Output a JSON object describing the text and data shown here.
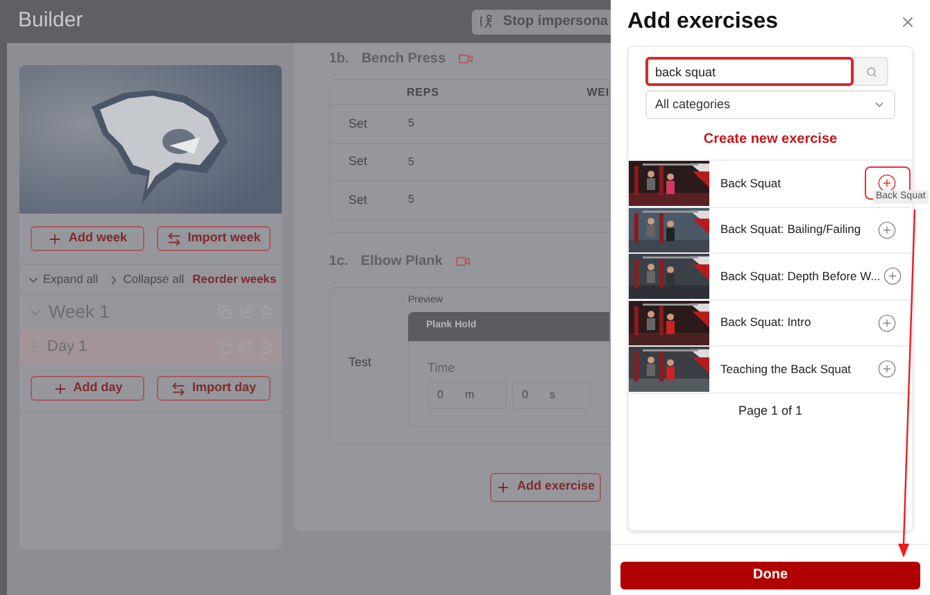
{
  "header": {
    "title": "Builder",
    "stop_button": "Stop impersona"
  },
  "program": {
    "week_buttons": [
      "Add week",
      "Import week"
    ],
    "expand": "Expand all",
    "collapse": "Collapse all",
    "reorder": "Reorder weeks",
    "weeks": [
      {
        "label": "Week 1",
        "expanded": true,
        "days": [
          {
            "label": "Day 1",
            "selected": true
          }
        ]
      }
    ],
    "day_buttons": [
      "Add day",
      "Import day"
    ]
  },
  "exercises": [
    {
      "kind": "sets",
      "number": "1b.",
      "name": "Bench Press",
      "columns": [
        "REPS",
        "WEI"
      ],
      "rows": [
        {
          "label": "Set",
          "reps": "5"
        },
        {
          "label": "Set",
          "reps": "5"
        },
        {
          "label": "Set",
          "reps": "5"
        }
      ]
    },
    {
      "kind": "timed",
      "number": "1c.",
      "name": "Elbow Plank",
      "preview_label": "Preview",
      "preview_title": "Plank Hold",
      "row_label": "Test",
      "field_label": "Time",
      "fields": [
        {
          "placeholder": "0",
          "unit": "m"
        },
        {
          "placeholder": "0",
          "unit": "s"
        }
      ]
    }
  ],
  "add_exercise_button": "Add exercise",
  "modal": {
    "title": "Add exercises",
    "search": {
      "value": "back squat"
    },
    "category": "All categories",
    "create_link": "Create new exercise",
    "results": [
      {
        "name": "Back Squat",
        "highlighted": true
      },
      {
        "name": "Back Squat: Bailing/Failing",
        "highlighted": false
      },
      {
        "name": "Back Squat: Depth Before W...",
        "highlighted": false
      },
      {
        "name": "Back Squat: Intro",
        "highlighted": false
      },
      {
        "name": "Teaching the Back Squat",
        "highlighted": false
      }
    ],
    "tooltip": "Back Squat",
    "pagination": "Page 1 of 1",
    "done_button": "Done"
  }
}
